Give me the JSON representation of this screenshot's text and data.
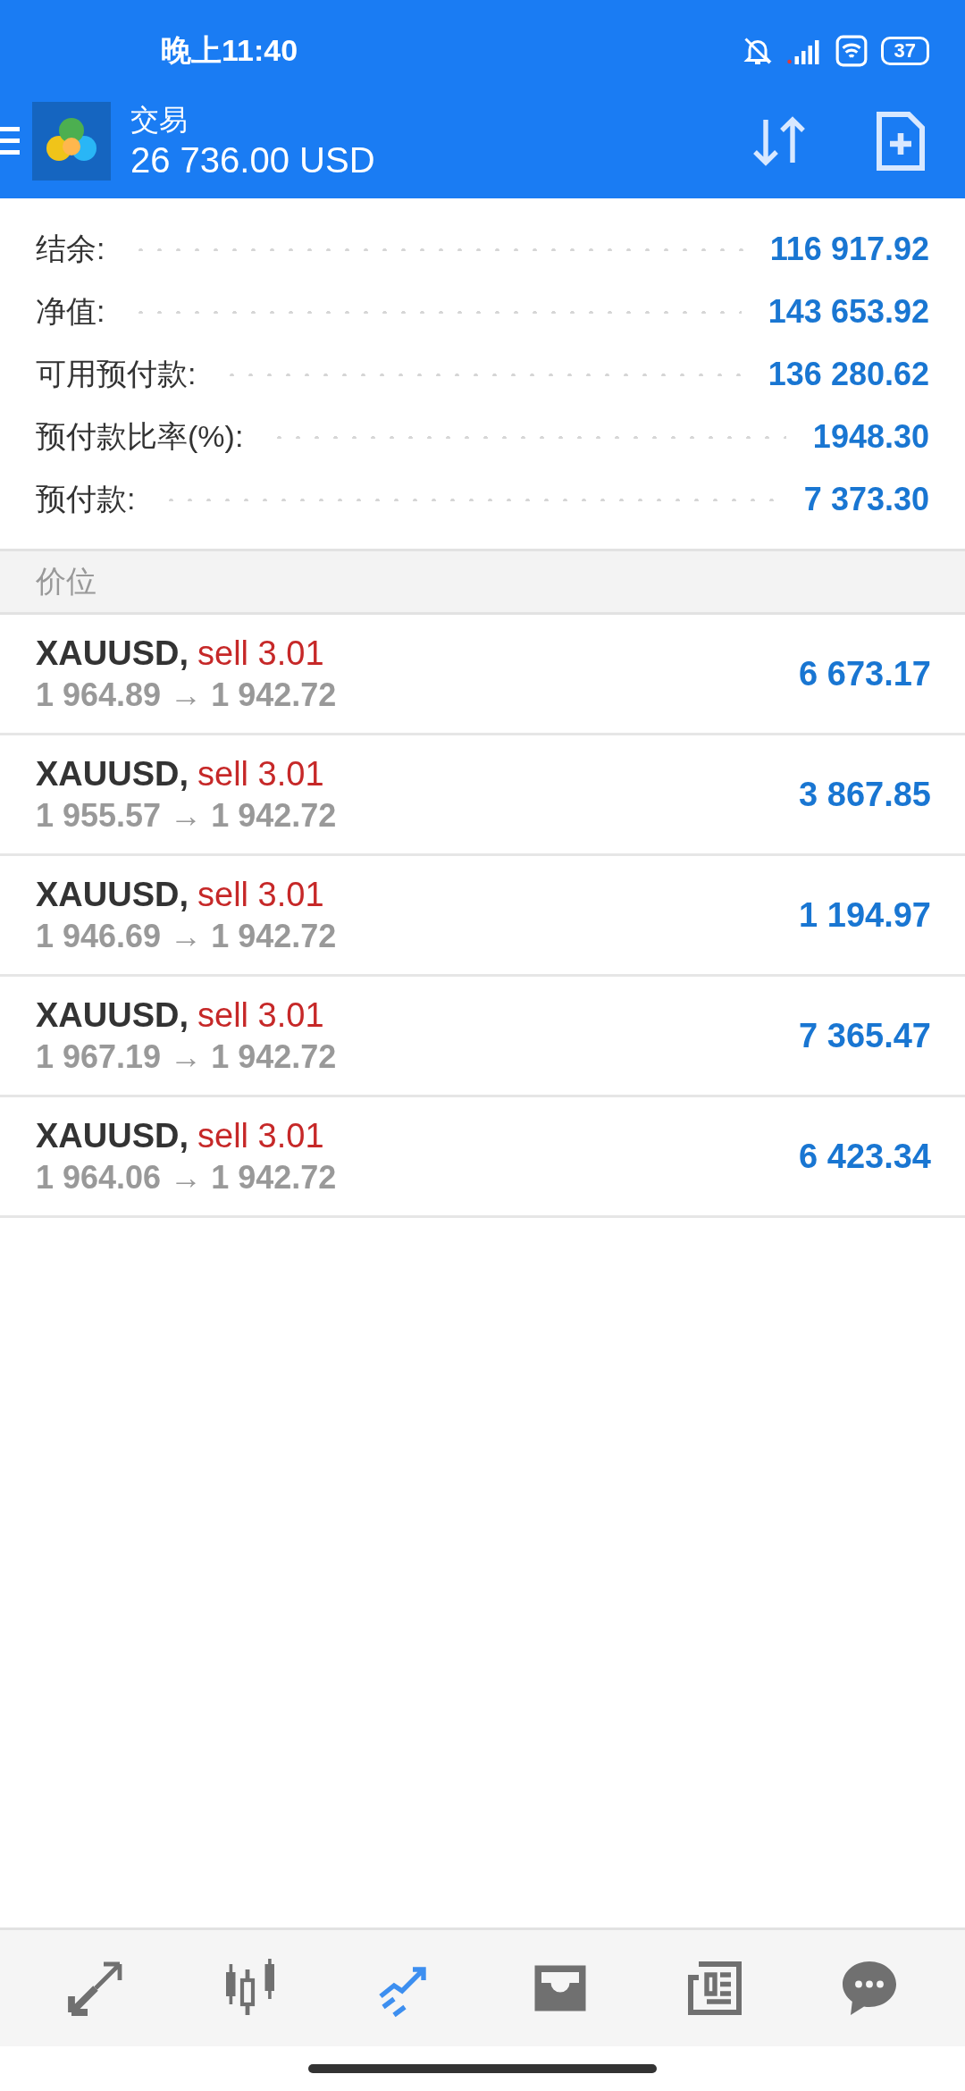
{
  "status_bar": {
    "time": "晚上11:40",
    "battery": "37"
  },
  "app_bar": {
    "title": "交易",
    "balance": "26 736.00 USD"
  },
  "summary": [
    {
      "label": "结余:",
      "value": "116 917.92"
    },
    {
      "label": "净值:",
      "value": "143 653.92"
    },
    {
      "label": "可用预付款:",
      "value": "136 280.62"
    },
    {
      "label": "预付款比率(%):",
      "value": "1948.30"
    },
    {
      "label": "预付款:",
      "value": "7 373.30"
    }
  ],
  "section_header": "价位",
  "positions": [
    {
      "symbol": "XAUUSD,",
      "side": "sell 3.01",
      "prices": "1 964.89 → 1 942.72",
      "profit": "6 673.17"
    },
    {
      "symbol": "XAUUSD,",
      "side": "sell 3.01",
      "prices": "1 955.57 → 1 942.72",
      "profit": "3 867.85"
    },
    {
      "symbol": "XAUUSD,",
      "side": "sell 3.01",
      "prices": "1 946.69 → 1 942.72",
      "profit": "1 194.97"
    },
    {
      "symbol": "XAUUSD,",
      "side": "sell 3.01",
      "prices": "1 967.19 → 1 942.72",
      "profit": "7 365.47"
    },
    {
      "symbol": "XAUUSD,",
      "side": "sell 3.01",
      "prices": "1 964.06 → 1 942.72",
      "profit": "6 423.34"
    }
  ],
  "bottom_nav": [
    {
      "kind": "quotes",
      "selected": false
    },
    {
      "kind": "chart",
      "selected": false
    },
    {
      "kind": "trade",
      "selected": true
    },
    {
      "kind": "history",
      "selected": false
    },
    {
      "kind": "news",
      "selected": false
    },
    {
      "kind": "chat",
      "selected": false
    }
  ]
}
